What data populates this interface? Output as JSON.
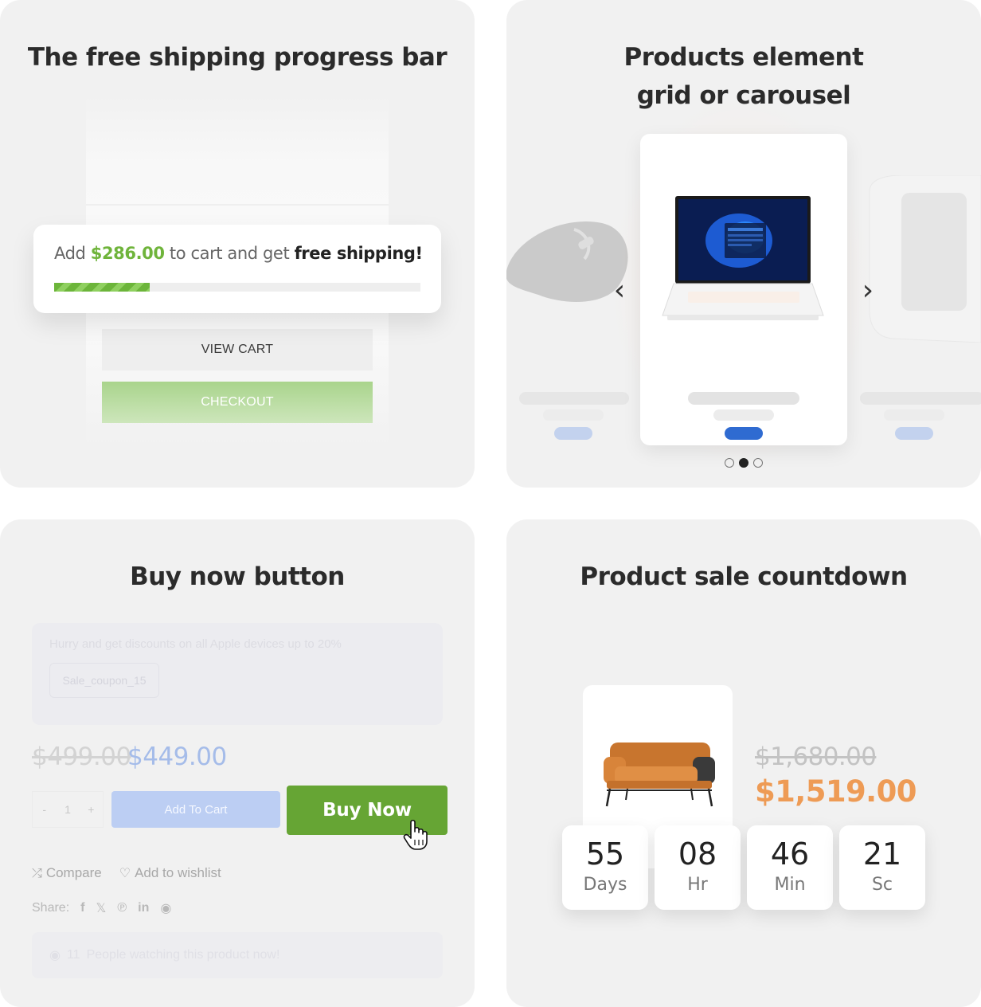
{
  "cards": {
    "shipping": {
      "title": "The free shipping progress bar",
      "message_prefix": "Add",
      "amount": "$286.00",
      "message_middle": "to cart and get",
      "message_free": "free shipping!",
      "progress": 0.26,
      "view_cart_label": "VIEW CART",
      "checkout_label": "CHECKOUT"
    },
    "products": {
      "title_line1": "Products element",
      "title_line2": "grid or carousel",
      "carousel_index": 1,
      "carousel_count": 3
    },
    "buynow": {
      "title": "Buy now button",
      "promo_text": "Hurry and get discounts on all Apple devices up to 20%",
      "coupon_code": "Sale_coupon_15",
      "old_price": "$499.00",
      "new_price": "$449.00",
      "qty_minus": "-",
      "qty_value": "1",
      "qty_plus": "+",
      "add_to_cart_label": "Add To Cart",
      "buy_now_label": "Buy Now",
      "compare_label": "Compare",
      "wishlist_label": "Add to wishlist",
      "share_label": "Share:",
      "watch_count": "11",
      "watch_text": "People watching this product now!"
    },
    "countdown": {
      "title": "Product sale countdown",
      "old_price": "$1,680.00",
      "new_price": "$1,519.00",
      "timers": [
        {
          "value": "55",
          "label": "Days"
        },
        {
          "value": "08",
          "label": "Hr"
        },
        {
          "value": "46",
          "label": "Min"
        },
        {
          "value": "21",
          "label": "Sc"
        }
      ]
    }
  },
  "colors": {
    "card_bg": "#f1f1f1",
    "shipping_green": "#6fb43b",
    "buy_now_green": "#66a534",
    "sale_orange": "#ee9b55",
    "carousel_blue": "#2f6bd1"
  }
}
